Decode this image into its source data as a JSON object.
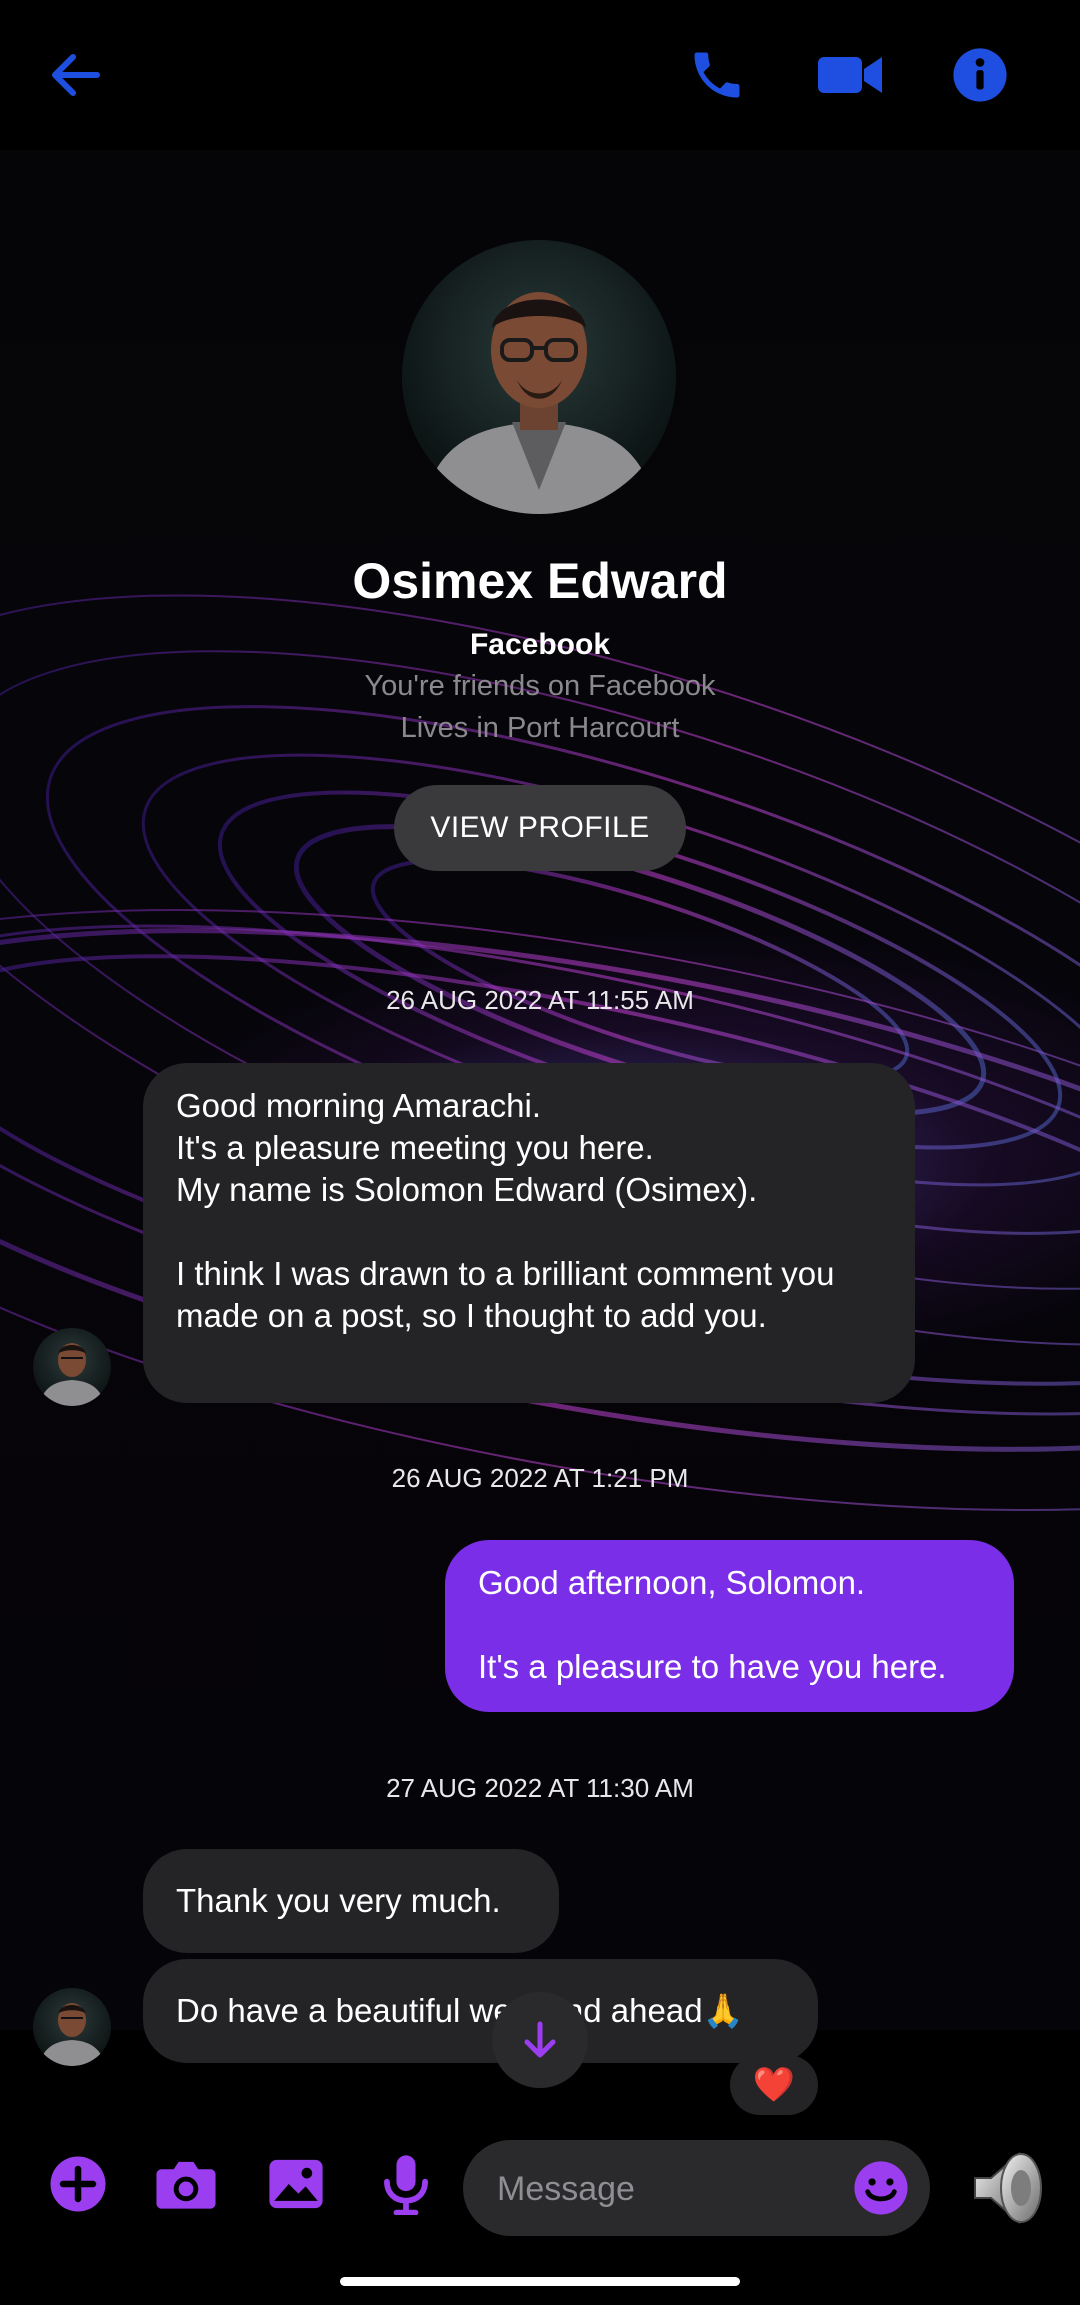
{
  "colors": {
    "accent_blue": "#1e4fe0",
    "accent_purple": "#9b3ef0",
    "outgoing_bubble": "#7b2ee8",
    "incoming_bubble": "#242426"
  },
  "topbar": {
    "back_icon": "arrow-left-icon",
    "call_icon": "phone-icon",
    "video_icon": "video-camera-icon",
    "info_icon": "info-icon"
  },
  "profile": {
    "name": "Osimex Edward",
    "source": "Facebook",
    "friend_status": "You're friends on Facebook",
    "location": "Lives in Port Harcourt",
    "view_profile_label": "VIEW PROFILE"
  },
  "messages": [
    {
      "timestamp": "26 AUG 2022 AT 11:55 AM"
    },
    {
      "direction": "incoming",
      "text": "Good morning Amarachi.\nIt's a pleasure meeting you here.\nMy name is Solomon Edward (Osimex).\n\nI think I was drawn to a brilliant comment you made on a post, so I thought to add you."
    },
    {
      "timestamp": "26 AUG 2022 AT 1:21 PM"
    },
    {
      "direction": "outgoing",
      "text": "Good afternoon, Solomon.\n\nIt's a pleasure to have you here."
    },
    {
      "timestamp": "27 AUG 2022 AT 11:30 AM"
    },
    {
      "direction": "incoming",
      "text": "Thank you very much."
    },
    {
      "direction": "incoming",
      "text": "Do have a beautiful weekend ahead🙏",
      "reaction": "❤️"
    }
  ],
  "composer": {
    "placeholder": "Message",
    "add_icon": "plus-circle-icon",
    "camera_icon": "camera-icon",
    "gallery_icon": "image-icon",
    "mic_icon": "microphone-icon",
    "emoji_icon": "smiley-icon",
    "send_icon": "speaker-sticker-icon"
  }
}
